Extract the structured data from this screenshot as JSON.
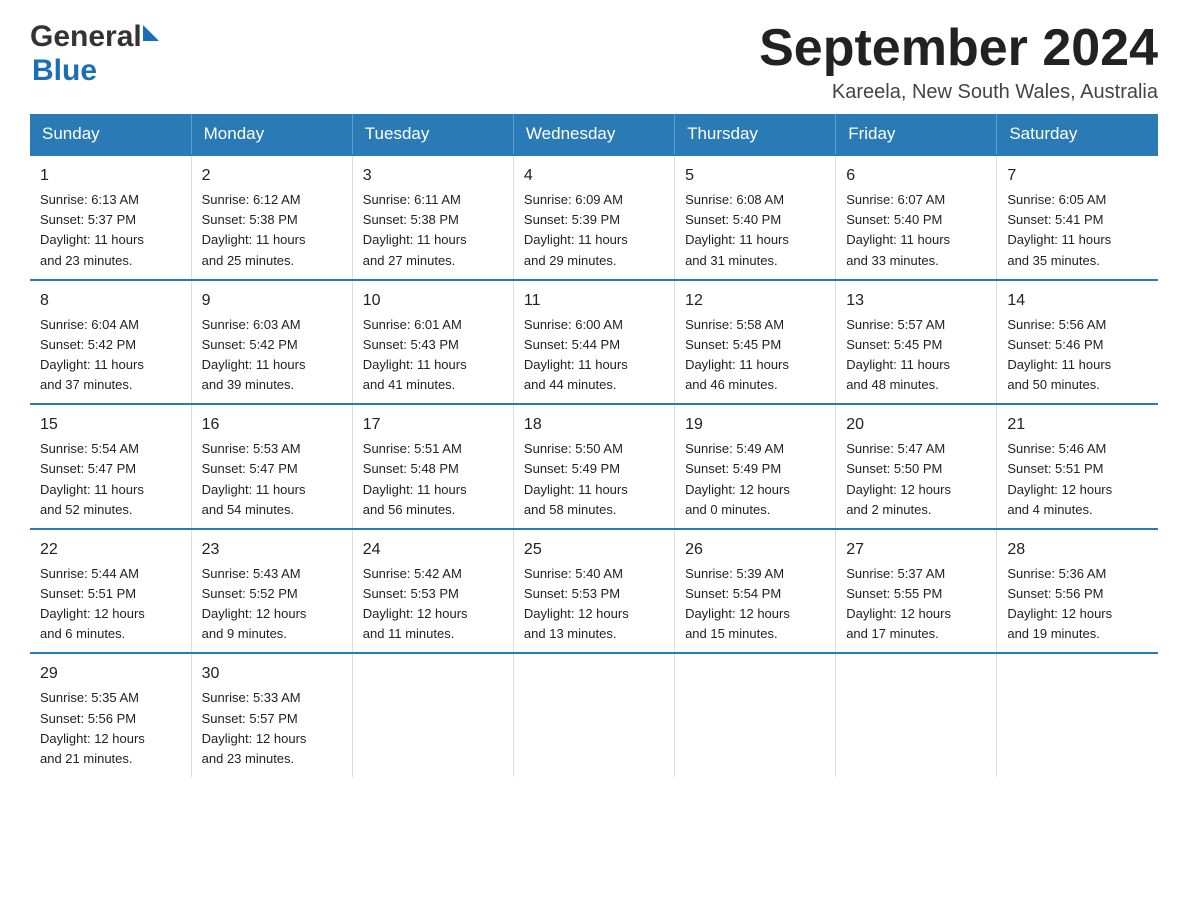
{
  "header": {
    "month_title": "September 2024",
    "location": "Kareela, New South Wales, Australia",
    "logo_general": "General",
    "logo_blue": "Blue"
  },
  "days_of_week": [
    "Sunday",
    "Monday",
    "Tuesday",
    "Wednesday",
    "Thursday",
    "Friday",
    "Saturday"
  ],
  "weeks": [
    [
      {
        "day": "1",
        "sunrise": "6:13 AM",
        "sunset": "5:37 PM",
        "daylight": "11 hours and 23 minutes."
      },
      {
        "day": "2",
        "sunrise": "6:12 AM",
        "sunset": "5:38 PM",
        "daylight": "11 hours and 25 minutes."
      },
      {
        "day": "3",
        "sunrise": "6:11 AM",
        "sunset": "5:38 PM",
        "daylight": "11 hours and 27 minutes."
      },
      {
        "day": "4",
        "sunrise": "6:09 AM",
        "sunset": "5:39 PM",
        "daylight": "11 hours and 29 minutes."
      },
      {
        "day": "5",
        "sunrise": "6:08 AM",
        "sunset": "5:40 PM",
        "daylight": "11 hours and 31 minutes."
      },
      {
        "day": "6",
        "sunrise": "6:07 AM",
        "sunset": "5:40 PM",
        "daylight": "11 hours and 33 minutes."
      },
      {
        "day": "7",
        "sunrise": "6:05 AM",
        "sunset": "5:41 PM",
        "daylight": "11 hours and 35 minutes."
      }
    ],
    [
      {
        "day": "8",
        "sunrise": "6:04 AM",
        "sunset": "5:42 PM",
        "daylight": "11 hours and 37 minutes."
      },
      {
        "day": "9",
        "sunrise": "6:03 AM",
        "sunset": "5:42 PM",
        "daylight": "11 hours and 39 minutes."
      },
      {
        "day": "10",
        "sunrise": "6:01 AM",
        "sunset": "5:43 PM",
        "daylight": "11 hours and 41 minutes."
      },
      {
        "day": "11",
        "sunrise": "6:00 AM",
        "sunset": "5:44 PM",
        "daylight": "11 hours and 44 minutes."
      },
      {
        "day": "12",
        "sunrise": "5:58 AM",
        "sunset": "5:45 PM",
        "daylight": "11 hours and 46 minutes."
      },
      {
        "day": "13",
        "sunrise": "5:57 AM",
        "sunset": "5:45 PM",
        "daylight": "11 hours and 48 minutes."
      },
      {
        "day": "14",
        "sunrise": "5:56 AM",
        "sunset": "5:46 PM",
        "daylight": "11 hours and 50 minutes."
      }
    ],
    [
      {
        "day": "15",
        "sunrise": "5:54 AM",
        "sunset": "5:47 PM",
        "daylight": "11 hours and 52 minutes."
      },
      {
        "day": "16",
        "sunrise": "5:53 AM",
        "sunset": "5:47 PM",
        "daylight": "11 hours and 54 minutes."
      },
      {
        "day": "17",
        "sunrise": "5:51 AM",
        "sunset": "5:48 PM",
        "daylight": "11 hours and 56 minutes."
      },
      {
        "day": "18",
        "sunrise": "5:50 AM",
        "sunset": "5:49 PM",
        "daylight": "11 hours and 58 minutes."
      },
      {
        "day": "19",
        "sunrise": "5:49 AM",
        "sunset": "5:49 PM",
        "daylight": "12 hours and 0 minutes."
      },
      {
        "day": "20",
        "sunrise": "5:47 AM",
        "sunset": "5:50 PM",
        "daylight": "12 hours and 2 minutes."
      },
      {
        "day": "21",
        "sunrise": "5:46 AM",
        "sunset": "5:51 PM",
        "daylight": "12 hours and 4 minutes."
      }
    ],
    [
      {
        "day": "22",
        "sunrise": "5:44 AM",
        "sunset": "5:51 PM",
        "daylight": "12 hours and 6 minutes."
      },
      {
        "day": "23",
        "sunrise": "5:43 AM",
        "sunset": "5:52 PM",
        "daylight": "12 hours and 9 minutes."
      },
      {
        "day": "24",
        "sunrise": "5:42 AM",
        "sunset": "5:53 PM",
        "daylight": "12 hours and 11 minutes."
      },
      {
        "day": "25",
        "sunrise": "5:40 AM",
        "sunset": "5:53 PM",
        "daylight": "12 hours and 13 minutes."
      },
      {
        "day": "26",
        "sunrise": "5:39 AM",
        "sunset": "5:54 PM",
        "daylight": "12 hours and 15 minutes."
      },
      {
        "day": "27",
        "sunrise": "5:37 AM",
        "sunset": "5:55 PM",
        "daylight": "12 hours and 17 minutes."
      },
      {
        "day": "28",
        "sunrise": "5:36 AM",
        "sunset": "5:56 PM",
        "daylight": "12 hours and 19 minutes."
      }
    ],
    [
      {
        "day": "29",
        "sunrise": "5:35 AM",
        "sunset": "5:56 PM",
        "daylight": "12 hours and 21 minutes."
      },
      {
        "day": "30",
        "sunrise": "5:33 AM",
        "sunset": "5:57 PM",
        "daylight": "12 hours and 23 minutes."
      },
      null,
      null,
      null,
      null,
      null
    ]
  ],
  "labels": {
    "sunrise": "Sunrise:",
    "sunset": "Sunset:",
    "daylight": "Daylight:"
  }
}
